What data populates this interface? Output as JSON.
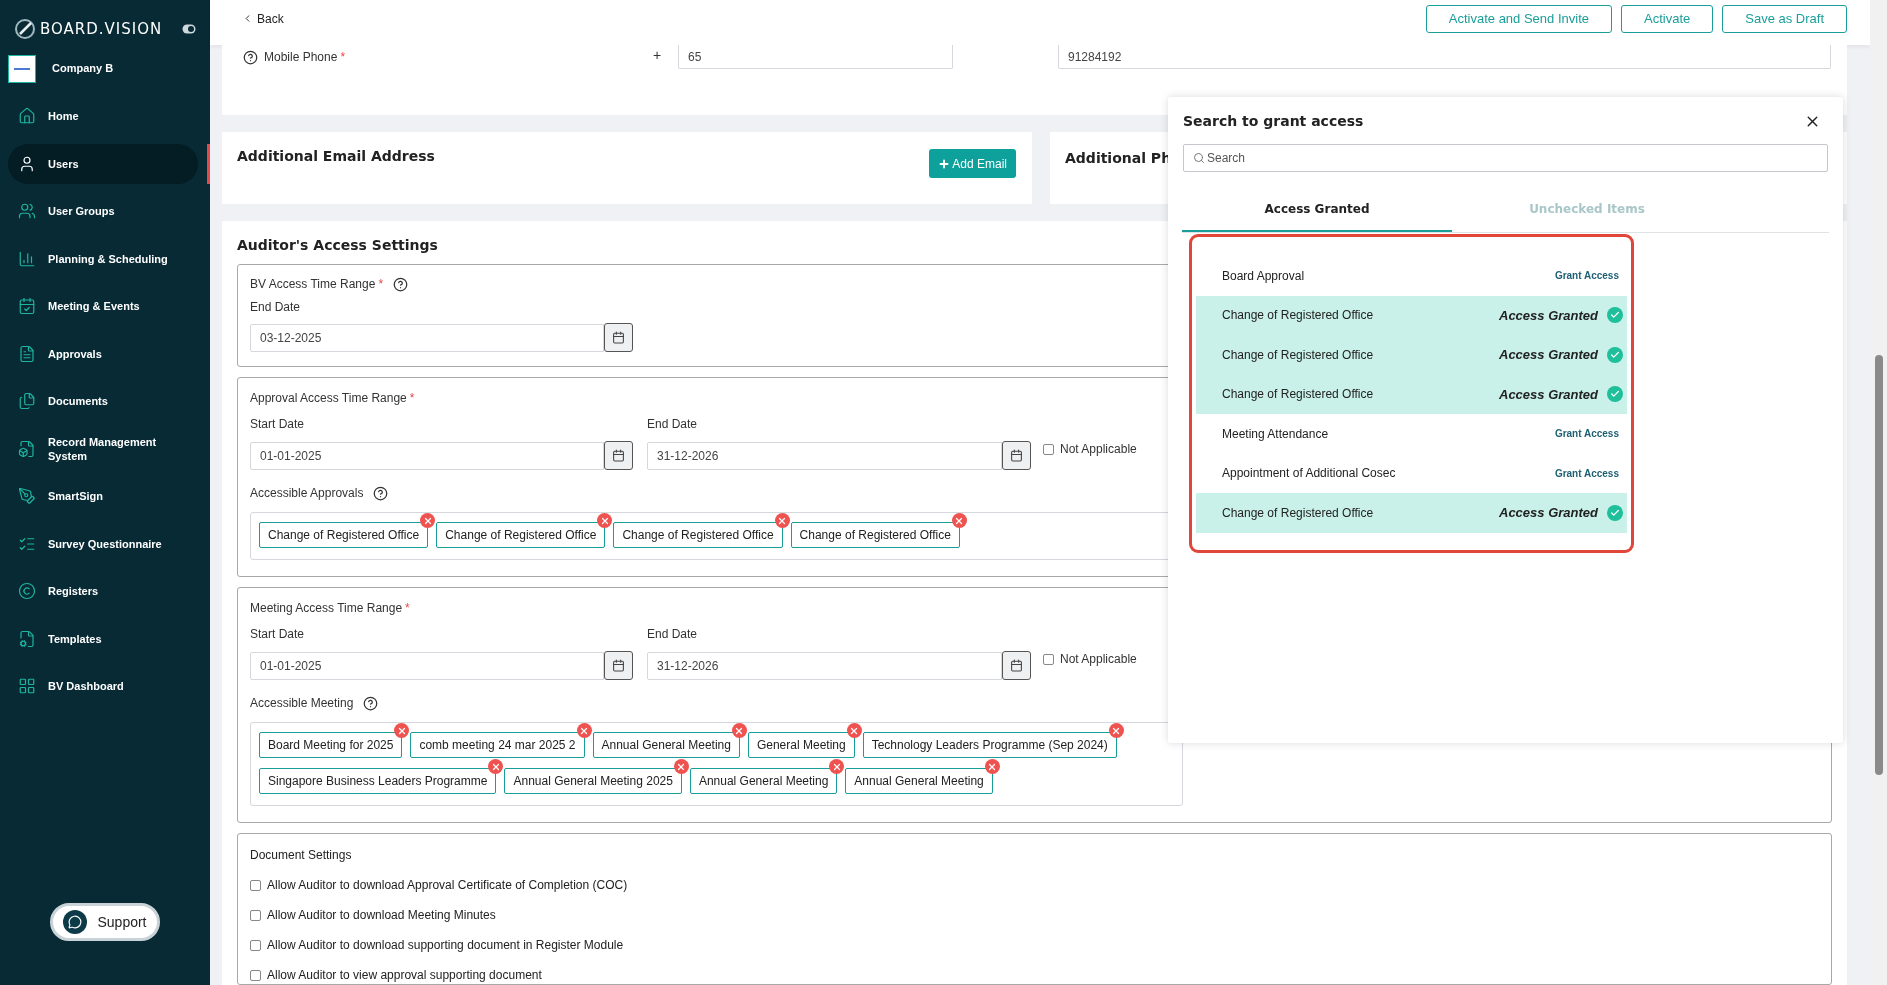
{
  "sidebar": {
    "brand": "BOARD.VISION",
    "company": "Company B",
    "items": [
      {
        "label": "Home",
        "selected": false
      },
      {
        "label": "Users",
        "selected": true
      },
      {
        "label": "User Groups",
        "selected": false
      },
      {
        "label": "Planning & Scheduling",
        "selected": false
      },
      {
        "label": "Meeting & Events",
        "selected": false
      },
      {
        "label": "Approvals",
        "selected": false
      },
      {
        "label": "Documents",
        "selected": false
      },
      {
        "label": "Record Management System",
        "selected": false
      },
      {
        "label": "SmartSign",
        "selected": false
      },
      {
        "label": "Survey Questionnaire",
        "selected": false
      },
      {
        "label": "Registers",
        "selected": false
      },
      {
        "label": "Templates",
        "selected": false
      },
      {
        "label": "BV Dashboard",
        "selected": false
      }
    ],
    "support": "Support"
  },
  "top_bar": {
    "back": "Back",
    "buttons": [
      "Activate and Send Invite",
      "Activate",
      "Save as Draft"
    ]
  },
  "mobile_phone": {
    "label": "Mobile Phone",
    "required": "*",
    "prefix": "+",
    "country_code": "65",
    "number": "91284192"
  },
  "additional_email": {
    "title": "Additional Email Address",
    "button": "Add Email"
  },
  "additional_phone": {
    "title": "Additional Ph"
  },
  "auditor_access": {
    "title": "Auditor's Access Settings",
    "bv_range": {
      "label": "BV Access Time Range",
      "required": "*",
      "end_label": "End Date",
      "end": "03-12-2025"
    },
    "approval_range": {
      "label": "Approval Access Time Range",
      "required": "*",
      "start_label": "Start Date",
      "start": "01-01-2025",
      "end_label": "End Date",
      "end": "31-12-2026",
      "not_applicable": {
        "label": "Not Applicable",
        "checked": false
      },
      "accessible_label": "Accessible Approvals",
      "tags": [
        "Change of Registered Office",
        "Change of Registered Office",
        "Change of Registered Office",
        "Change of Registered Office"
      ]
    },
    "meeting_range": {
      "label": "Meeting Access Time Range",
      "required": "*",
      "start_label": "Start Date",
      "start": "01-01-2025",
      "end_label": "End Date",
      "end": "31-12-2026",
      "not_applicable": {
        "label": "Not Applicable",
        "checked": false
      },
      "accessible_label": "Accessible Meeting",
      "tags": [
        "Board Meeting for 2025",
        "comb meeting 24 mar 2025 2",
        "Annual General Meeting",
        "General Meeting",
        "Technology Leaders Programme (Sep 2024)",
        "Singapore Business Leaders Programme",
        "Annual General Meeting 2025",
        "Annual General Meeting",
        "Annual General Meeting"
      ]
    },
    "document_settings": {
      "title": "Document Settings",
      "options": [
        {
          "label": "Allow Auditor to download Approval Certificate of Completion (COC)",
          "checked": false
        },
        {
          "label": "Allow Auditor to download Meeting Minutes",
          "checked": false
        },
        {
          "label": "Allow Auditor to download supporting document in Register Module",
          "checked": false
        },
        {
          "label": "Allow Auditor to view approval supporting document",
          "checked": false
        }
      ]
    }
  },
  "grant_popup": {
    "title": "Search to grant access",
    "search_placeholder": "Search",
    "tabs": [
      {
        "label": "Access Granted",
        "selected": true
      },
      {
        "label": "Unchecked Items",
        "selected": false
      }
    ],
    "items": [
      {
        "name": "Board Approval",
        "granted": false,
        "action": "Grant Access"
      },
      {
        "name": "Change of Registered Office",
        "granted": true,
        "action": "Access Granted"
      },
      {
        "name": "Change of Registered Office",
        "granted": true,
        "action": "Access Granted"
      },
      {
        "name": "Change of Registered Office",
        "granted": true,
        "action": "Access Granted"
      },
      {
        "name": "Meeting Attendance",
        "granted": false,
        "action": "Grant Access"
      },
      {
        "name": "Appointment of Additional Cosec",
        "granted": false,
        "action": "Grant Access"
      },
      {
        "name": "Change of Registered Office",
        "granted": true,
        "action": "Access Granted"
      }
    ]
  }
}
